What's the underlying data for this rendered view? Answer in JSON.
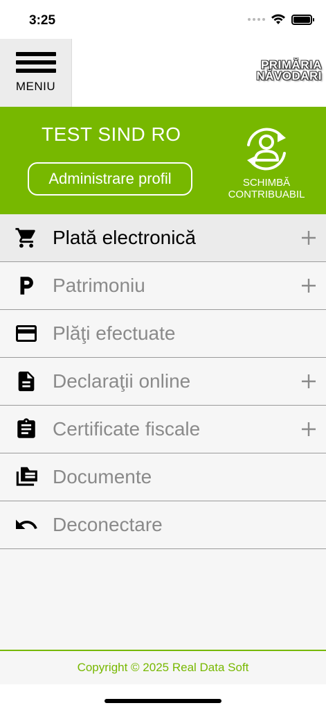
{
  "status_bar": {
    "time": "3:25"
  },
  "header": {
    "menu_label": "MENIU",
    "logo_line1": "PRIMĂRIA",
    "logo_line2": "NĂVODARI"
  },
  "profile": {
    "user_name": "TEST SIND RO",
    "admin_button": "Administrare profil",
    "switch_label_line1": "SCHIMBĂ",
    "switch_label_line2": "CONTRIBUABIL"
  },
  "menu": {
    "items": [
      {
        "label": "Plată electronică",
        "icon": "cart-icon",
        "expandable": true,
        "active": true
      },
      {
        "label": "Patrimoniu",
        "icon": "parking-p-icon",
        "expandable": true,
        "active": false
      },
      {
        "label": "Plăţi efectuate",
        "icon": "credit-card-icon",
        "expandable": false,
        "active": false
      },
      {
        "label": "Declaraţii online",
        "icon": "document-icon",
        "expandable": true,
        "active": false
      },
      {
        "label": "Certificate fiscale",
        "icon": "clipboard-icon",
        "expandable": true,
        "active": false
      },
      {
        "label": "Documente",
        "icon": "folder-icon",
        "expandable": false,
        "active": false
      },
      {
        "label": "Deconectare",
        "icon": "undo-arrow-icon",
        "expandable": false,
        "active": false
      }
    ]
  },
  "footer": {
    "copyright": "Copyright © 2025 Real Data Soft"
  },
  "colors": {
    "accent": "#77b800",
    "menu_text_inactive": "#8a8a8a",
    "menu_text_active": "#000000"
  }
}
